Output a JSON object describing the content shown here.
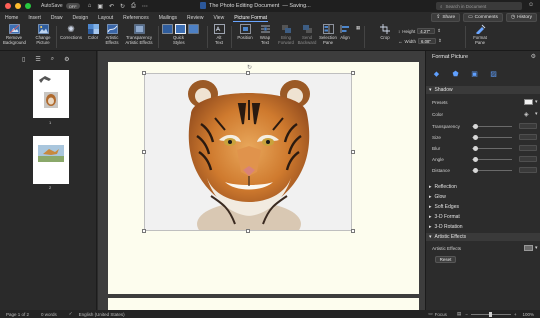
{
  "titlebar": {
    "autosave_label": "AutoSave",
    "autosave_state": "OFF",
    "document_title": "The Photo Editing Document",
    "save_state": "— Saving...",
    "search_placeholder": "Search in Document"
  },
  "tabs": [
    "Home",
    "Insert",
    "Draw",
    "Design",
    "Layout",
    "References",
    "Mailings",
    "Review",
    "View",
    "Picture Format"
  ],
  "active_tab": "Picture Format",
  "tab_actions": {
    "share": "Share",
    "comments": "Comments",
    "history": "History"
  },
  "ribbon": {
    "remove_background": [
      "Remove",
      "Background"
    ],
    "change_picture": [
      "Change",
      "Picture"
    ],
    "corrections": "Corrections",
    "color": "Color",
    "artistic_effects": [
      "Artistic",
      "Effects"
    ],
    "transparency": "Transparency",
    "artistic_effects_label": "Artistic Effects",
    "quick_styles": [
      "Quick",
      "Styles"
    ],
    "alt_text": [
      "Alt",
      "Text"
    ],
    "position": "Position",
    "wrap_text": [
      "Wrap",
      "Text"
    ],
    "bring_forward": [
      "Bring",
      "Forward"
    ],
    "send_backward": [
      "Send",
      "Backward"
    ],
    "selection_pane": [
      "Selection",
      "Pane"
    ],
    "align": "Align",
    "crop": "Crop",
    "height_label": "Height",
    "height_value": "4.27\"",
    "width_label": "Width",
    "width_value": "6.08\"",
    "format_pane": [
      "Format",
      "Pane"
    ]
  },
  "thumbnails": [
    {
      "page": "1"
    },
    {
      "page": "2"
    }
  ],
  "pane": {
    "title": "Format Picture",
    "shadow": {
      "heading": "Shadow",
      "rows": [
        "Presets",
        "Color",
        "Transparency",
        "Size",
        "Blur",
        "Angle",
        "Distance"
      ]
    },
    "sections": [
      "Reflection",
      "Glow",
      "Soft Edges",
      "3-D Format",
      "3-D Rotation"
    ],
    "artistic": {
      "heading": "Artistic Effects",
      "label": "Artistic Effects",
      "reset": "Reset"
    }
  },
  "status": {
    "page": "Page 1 of 2",
    "words": "0 words",
    "language": "English (United States)",
    "focus": "Focus",
    "zoom": "100%"
  },
  "colors": {
    "accent": "#6aa5ff",
    "page": "#fdfdee",
    "close": "#ff5f57",
    "minimize": "#febc2e",
    "maximize": "#28c840"
  }
}
